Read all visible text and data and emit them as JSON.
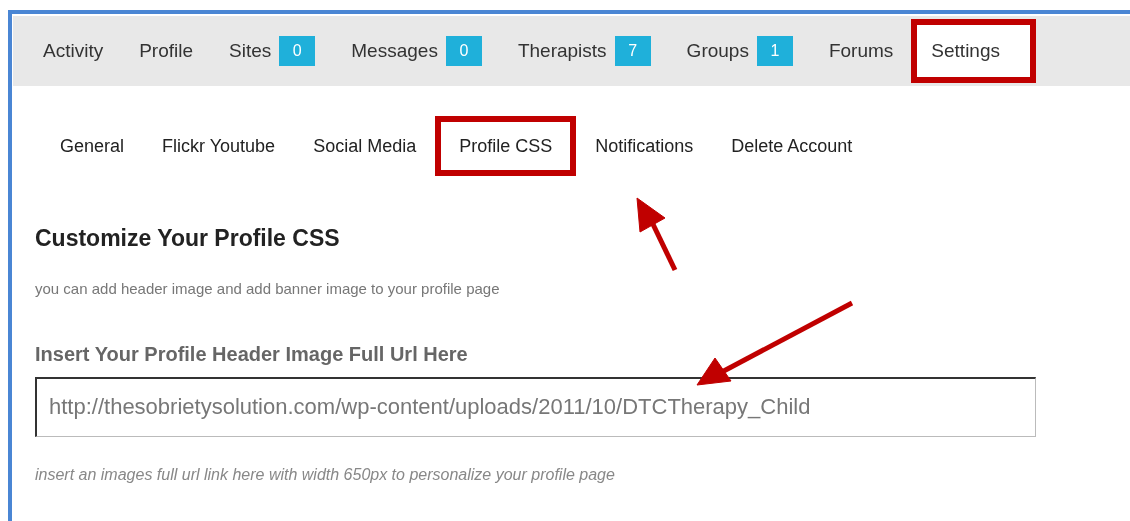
{
  "nav_tabs": [
    {
      "label": "Activity",
      "selected": false
    },
    {
      "label": "Profile",
      "selected": false
    },
    {
      "label": "Sites",
      "count": "0",
      "selected": false
    },
    {
      "label": "Messages",
      "count": "0",
      "selected": false
    },
    {
      "label": "Therapists",
      "count": "7",
      "selected": false
    },
    {
      "label": "Groups",
      "count": "1",
      "selected": false
    },
    {
      "label": "Forums",
      "selected": false
    },
    {
      "label": "Settings",
      "selected": true
    }
  ],
  "sub_tabs": [
    {
      "label": "General",
      "selected": false
    },
    {
      "label": "Flickr Youtube",
      "selected": false
    },
    {
      "label": "Social Media",
      "selected": false
    },
    {
      "label": "Profile CSS",
      "selected": true
    },
    {
      "label": "Notifications",
      "selected": false
    },
    {
      "label": "Delete Account",
      "selected": false
    }
  ],
  "section": {
    "title": "Customize Your Profile CSS",
    "description": "you can add header image and add banner image to your profile page"
  },
  "header_image_field": {
    "label": "Insert Your Profile Header Image Full Url Here",
    "value": "http://thesobrietysolution.com/wp-content/uploads/2011/10/DTCTherapy_Child",
    "hint": "insert an images full url link here with width 650px to personalize your profile page"
  }
}
